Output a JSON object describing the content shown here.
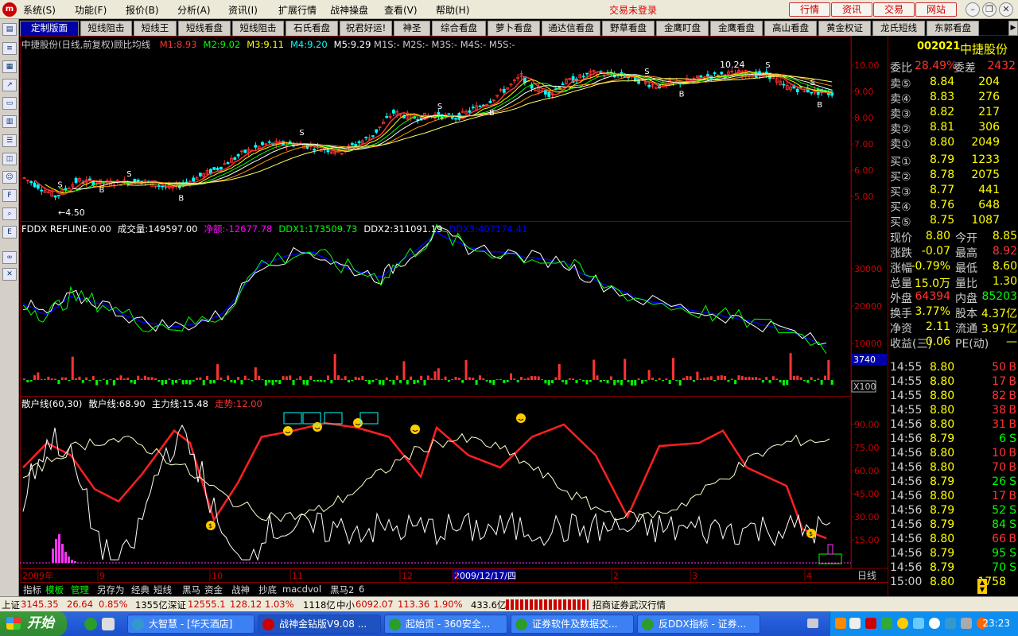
{
  "menu": {
    "items": [
      "系统(S)",
      "功能(F)",
      "报价(B)",
      "分析(A)",
      "资讯(I)",
      "扩展行情",
      "战神操盘",
      "查看(V)",
      "帮助(H)"
    ],
    "status": "交易未登录",
    "buttons": [
      "行情",
      "资讯",
      "交易",
      "网站"
    ]
  },
  "tabs": [
    "定制版面",
    "短线阻击",
    "短线王",
    "短线看盘",
    "短线阻击",
    "石氏看盘",
    "祝君好运!",
    "神圣",
    "综合看盘",
    "萝卜看盘",
    "通达信看盘",
    "野草看盘",
    "金鹰盯盘",
    "金鹰看盘",
    "高山看盘",
    "黄金权证",
    "龙氏短线",
    "东郭看盘"
  ],
  "colors": {
    "up": "#ff3333",
    "down": "#00ffff",
    "ma1": "#ff3333",
    "ma2": "#00ff00",
    "ma3": "#ffff00",
    "ma4": "#ffffff",
    "grid": "#800000"
  },
  "price_pane": {
    "title": "中捷股份(日线,前复权)顾比均线",
    "mas": [
      {
        "label": "M1:8.93",
        "color": "#ff3333"
      },
      {
        "label": "M2:9.02",
        "color": "#00ff00"
      },
      {
        "label": "M3:9.11",
        "color": "#ffff00"
      },
      {
        "label": "M4:9.20",
        "color": "#00ffff"
      },
      {
        "label": "M5:9.29",
        "color": "#ffffff"
      }
    ],
    "extra": "M1S:- M2S:- M3S:- M4S:- M5S:-",
    "y_ticks": [
      "10.00",
      "9.00",
      "8.00",
      "7.00",
      "6.00",
      "5.00"
    ],
    "high_label": "10.24",
    "low_label": "←4.50"
  },
  "ddx_pane": {
    "items": [
      {
        "label": "FDDX REFLINE:0.00",
        "color": "#ffffff"
      },
      {
        "label": "成交量:149597.00",
        "color": "#ffffff"
      },
      {
        "label": "净额:-12677.78",
        "color": "#ff00ff"
      },
      {
        "label": "DDX1:173509.73",
        "color": "#00ff00"
      },
      {
        "label": "DDX2:311091.19",
        "color": "#ffffff"
      },
      {
        "label": "DDX3:407174.41",
        "color": "#0000ff"
      }
    ],
    "y_ticks": [
      "30000",
      "20000",
      "10000"
    ],
    "last_value": "3740",
    "scale": "X100"
  },
  "retail_pane": {
    "items": [
      {
        "label": "散户线(60,30)",
        "color": "#ffffff"
      },
      {
        "label": "散户线:68.90",
        "color": "#ffffff"
      },
      {
        "label": "主力线:15.48",
        "color": "#ffffff"
      },
      {
        "label": "走势:12.00",
        "color": "#ff3333"
      }
    ],
    "y_ticks": [
      "90.00",
      "75.00",
      "60.00",
      "45.00",
      "30.00",
      "15.00"
    ]
  },
  "time_axis": {
    "labels": [
      "2009年",
      "9",
      "10",
      "11",
      "12",
      "2009/12/17/四",
      "1",
      "2",
      "3",
      "4"
    ],
    "period": "日线"
  },
  "bottom_tabs": [
    "指标",
    "模板",
    "管理",
    "另存为",
    "经典",
    "短线",
    "黑马",
    "资金",
    "战神",
    "抄底",
    "macd",
    "vol",
    "黑马2",
    "6"
  ],
  "quote": {
    "code": "002021",
    "name": "中捷股份",
    "webi_label": "委比",
    "webi": "28.49%",
    "weicha_label": "委差",
    "weicha": "2432",
    "sell": [
      {
        "label": "卖⑤",
        "price": "8.84",
        "vol": "204"
      },
      {
        "label": "卖④",
        "price": "8.83",
        "vol": "276"
      },
      {
        "label": "卖③",
        "price": "8.82",
        "vol": "217"
      },
      {
        "label": "卖②",
        "price": "8.81",
        "vol": "306"
      },
      {
        "label": "卖①",
        "price": "8.80",
        "vol": "2049"
      }
    ],
    "buy": [
      {
        "label": "买①",
        "price": "8.79",
        "vol": "1233"
      },
      {
        "label": "买②",
        "price": "8.78",
        "vol": "2075"
      },
      {
        "label": "买③",
        "price": "8.77",
        "vol": "441"
      },
      {
        "label": "买④",
        "price": "8.76",
        "vol": "648"
      },
      {
        "label": "买⑤",
        "price": "8.75",
        "vol": "1087"
      }
    ],
    "stats": [
      {
        "l1": "现价",
        "v1": "8.80",
        "c1": "#ffff00",
        "l2": "今开",
        "v2": "8.85",
        "c2": "#ffff00"
      },
      {
        "l1": "涨跌",
        "v1": "-0.07",
        "c1": "#ffff00",
        "l2": "最高",
        "v2": "8.92",
        "c2": "#ff3333"
      },
      {
        "l1": "涨幅",
        "v1": "-0.79%",
        "c1": "#ffff00",
        "l2": "最低",
        "v2": "8.60",
        "c2": "#ffff00"
      },
      {
        "l1": "总量",
        "v1": "15.0万",
        "c1": "#ffff00",
        "l2": "量比",
        "v2": "1.30",
        "c2": "#ffff00"
      },
      {
        "l1": "外盘",
        "v1": "64394",
        "c1": "#ff3333",
        "l2": "内盘",
        "v2": "85203",
        "c2": "#00ff00"
      },
      {
        "l1": "换手",
        "v1": "3.77%",
        "c1": "#ffff00",
        "l2": "股本",
        "v2": "4.37亿",
        "c2": "#ffff00"
      },
      {
        "l1": "净资",
        "v1": "2.11",
        "c1": "#ffff00",
        "l2": "流通",
        "v2": "3.97亿",
        "c2": "#ffff00"
      },
      {
        "l1": "收益(三)",
        "v1": "0.06",
        "c1": "#ffff00",
        "l2": "PE(动)",
        "v2": "—",
        "c2": "#ffff00"
      }
    ],
    "ticks": [
      {
        "t": "14:55",
        "p": "8.80",
        "v": "50",
        "d": "B"
      },
      {
        "t": "14:55",
        "p": "8.80",
        "v": "17",
        "d": "B"
      },
      {
        "t": "14:55",
        "p": "8.80",
        "v": "82",
        "d": "B"
      },
      {
        "t": "14:55",
        "p": "8.80",
        "v": "38",
        "d": "B"
      },
      {
        "t": "14:56",
        "p": "8.80",
        "v": "31",
        "d": "B"
      },
      {
        "t": "14:56",
        "p": "8.79",
        "v": "6",
        "d": "S"
      },
      {
        "t": "14:56",
        "p": "8.80",
        "v": "10",
        "d": "B"
      },
      {
        "t": "14:56",
        "p": "8.80",
        "v": "70",
        "d": "B"
      },
      {
        "t": "14:56",
        "p": "8.79",
        "v": "26",
        "d": "S"
      },
      {
        "t": "14:56",
        "p": "8.80",
        "v": "17",
        "d": "B"
      },
      {
        "t": "14:56",
        "p": "8.79",
        "v": "52",
        "d": "S"
      },
      {
        "t": "14:56",
        "p": "8.79",
        "v": "84",
        "d": "S"
      },
      {
        "t": "14:56",
        "p": "8.80",
        "v": "66",
        "d": "B"
      },
      {
        "t": "14:56",
        "p": "8.79",
        "v": "95",
        "d": "S"
      },
      {
        "t": "14:56",
        "p": "8.79",
        "v": "70",
        "d": "S"
      },
      {
        "t": "15:00",
        "p": "8.80",
        "v": "1758",
        "d": ""
      }
    ]
  },
  "indexbar": {
    "sh_label": "上证",
    "sh": "3145.35",
    "sh_chg": "26.64",
    "sh_pct": "0.85%",
    "sh_amt": "1355亿",
    "sz_label": "深证",
    "sz": "12555.1",
    "sz_chg": "128.12",
    "sz_pct": "1.03%",
    "sz_amt": "1118亿",
    "zx_label": "中小",
    "zx": "6092.07",
    "zx_chg": "113.36",
    "zx_pct": "1.90%",
    "zx_amt": "433.6亿",
    "broker": "招商证券武汉行情"
  },
  "taskbar": {
    "start": "开始",
    "tasks": [
      "大智慧 - [华天酒店]",
      "战神金钻版V9.08 ...",
      "起始页 - 360安全...",
      "证券软件及数据交...",
      "反DDX指标 - 证券..."
    ],
    "clock": "23:23"
  }
}
